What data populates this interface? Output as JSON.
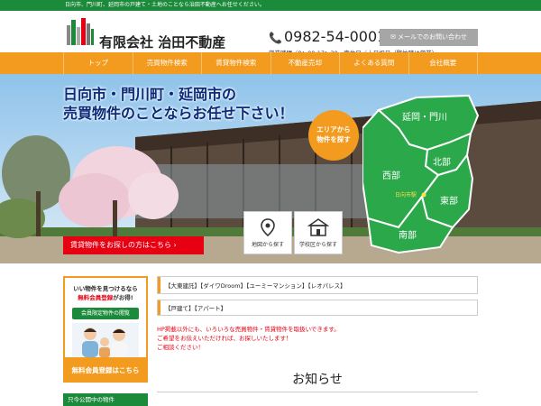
{
  "topbar": {
    "text": "日向市、門川町、延岡市の戸建て・土地のことなら治田不動産へお任せください。"
  },
  "header": {
    "company": "有限会社 治田不動産",
    "phone": "0982-54-0001",
    "hours": "営業時間／9：00-17：30　定休日／土日祝日（繁忙時は営業）",
    "mail_button": "メールでのお問い合わせ"
  },
  "nav": {
    "items": [
      "トップ",
      "売買物件検索",
      "賃貸物件検索",
      "不動産売却",
      "よくある質問",
      "会社概要"
    ]
  },
  "hero": {
    "title_line1": "日向市・門川町・延岡市の",
    "title_line2": "売買物件のことならお任せ下さい！",
    "area_button_line1": "エリアから",
    "area_button_line2": "物件を探す",
    "map": {
      "regions": [
        "延岡・門川",
        "北部",
        "西部",
        "東部",
        "南部"
      ],
      "station": "日向市駅"
    },
    "rent_button": "賃貸物件をお探しの方はこちら",
    "search_map": "地図から探す",
    "search_school": "学校区から探す"
  },
  "sidebar": {
    "line1": "いい物件を見つけるなら",
    "line2_red": "無料会員登録",
    "line2_rest": "がお得!",
    "green_button": "会員限定物件の閲覧",
    "bottom_button": "無料会員登録はこちら",
    "next_heading": "只今公開中の物件"
  },
  "main": {
    "tags1": "【大東建託】【ダイワDroom】【ユーミーマンション】【レオパレス】",
    "tags2": "【戸建て】【アパート】",
    "notice1": "HP掲載以外にも、いろいろな売買物件・賃貸物件を取扱いできます。",
    "notice2": "ご希望をお伝えいただければ、お探しいたします！",
    "notice3": "ご相談ください！",
    "news_title": "お知らせ"
  },
  "colors": {
    "green": "#1b8a3a",
    "orange": "#f29b1f",
    "red": "#e60012",
    "navy": "#0b2a7a"
  }
}
